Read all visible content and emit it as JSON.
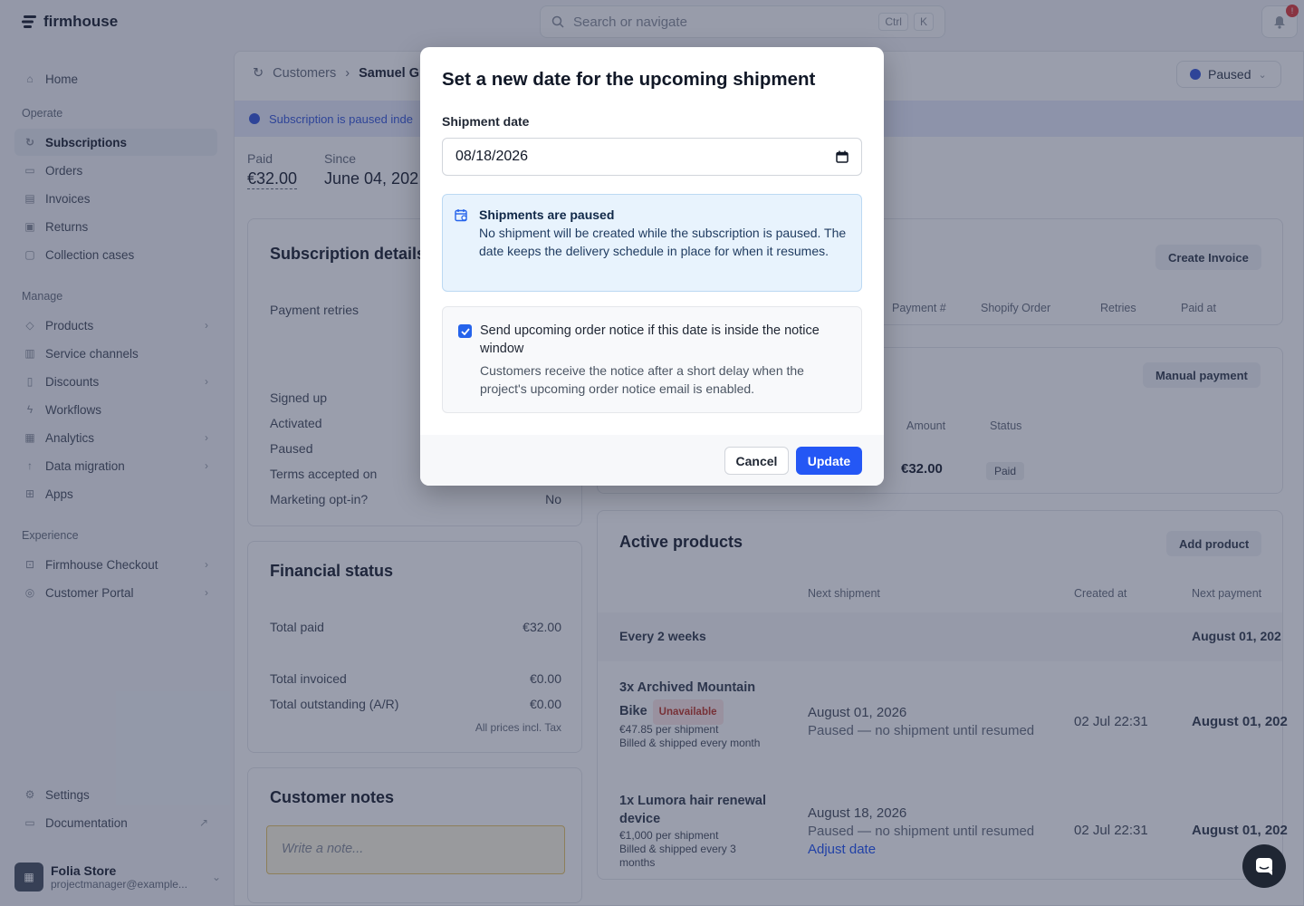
{
  "brand": {
    "name": "firmhouse"
  },
  "search": {
    "placeholder": "Search or navigate",
    "kbd1": "Ctrl",
    "kbd2": "K"
  },
  "notifications": {
    "count": "!"
  },
  "sidebar": {
    "home": "Home",
    "operate_label": "Operate",
    "operate": [
      "Subscriptions",
      "Orders",
      "Invoices",
      "Returns",
      "Collection cases"
    ],
    "manage_label": "Manage",
    "manage": [
      "Products",
      "Service channels",
      "Discounts",
      "Workflows",
      "Analytics",
      "Data migration",
      "Apps"
    ],
    "experience_label": "Experience",
    "experience": [
      "Firmhouse Checkout",
      "Customer Portal"
    ],
    "settings": "Settings",
    "documentation": "Documentation",
    "account": {
      "name": "Folia Store",
      "email": "projectmanager@example..."
    }
  },
  "page": {
    "breadcrumb_root": "Customers",
    "breadcrumb_current": "Samuel Gr",
    "status": "Paused",
    "banner": "Subscription is paused inde",
    "paid_label": "Paid",
    "paid_value": "€32.00",
    "since_label": "Since",
    "since_value": "June 04, 202"
  },
  "details": {
    "title": "Subscription details",
    "payment_retries": "Payment retries",
    "signed_up": "Signed up",
    "activated": "Activated",
    "paused": "Paused",
    "terms": "Terms accepted on",
    "marketing": "Marketing opt-in?",
    "marketing_value": "No"
  },
  "financial": {
    "title": "Financial status",
    "total_paid": "Total paid",
    "total_paid_value": "€32.00",
    "total_invoiced": "Total invoiced",
    "total_invoiced_value": "€0.00",
    "total_outstanding": "Total outstanding (A/R)",
    "total_outstanding_value": "€0.00",
    "note": "All prices incl. Tax"
  },
  "notes": {
    "title": "Customer notes",
    "placeholder": "Write a note..."
  },
  "invoices": {
    "create_button": "Create Invoice",
    "headers": [
      "Payment #",
      "Shopify Order",
      "Retries",
      "Paid at"
    ]
  },
  "payments": {
    "manual_button": "Manual payment",
    "headers": [
      "Amount",
      "Status"
    ],
    "amount": "€32.00",
    "status": "Paid"
  },
  "products": {
    "title": "Active products",
    "add_button": "Add product",
    "headers": [
      "Next shipment",
      "Created at",
      "Next payment"
    ],
    "group": "Every 2 weeks",
    "group_next_payment": "August 01, 202",
    "items": [
      {
        "name_line1": "3x Archived Mountain",
        "name_line2": "Bike",
        "badge": "Unavailable",
        "price": "€47.85 per shipment",
        "billing": "Billed & shipped every month",
        "next_shipment": "August 01, 2026",
        "note": "Paused — no shipment until resumed",
        "created": "02 Jul 22:31",
        "next_payment": "August 01, 202"
      },
      {
        "name_line1": "1x Lumora hair renewal",
        "name_line2": "device",
        "price": "€1,000 per shipment",
        "billing": "Billed & shipped every 3 months",
        "next_shipment": "August 18, 2026",
        "note": "Paused — no shipment until resumed",
        "link": "Adjust date",
        "created": "02 Jul 22:31",
        "next_payment": "August 01, 202"
      }
    ]
  },
  "modal": {
    "title": "Set a new date for the upcoming shipment",
    "date_label": "Shipment date",
    "date_value": "08/18/2026",
    "info_title": "Shipments are paused",
    "info_body": "No shipment will be created while the subscription is paused. The date keeps the delivery schedule in place for when it resumes.",
    "checkbox_label": "Send upcoming order notice if this date is inside the notice window",
    "checkbox_checked": true,
    "checkbox_help": "Customers receive the notice after a short delay when the project's upcoming order notice email is enabled.",
    "cancel": "Cancel",
    "update": "Update"
  },
  "colors": {
    "accent": "#2457f5",
    "info_bg": "#e8f3fd",
    "overlay": "rgba(30,41,72,0.45)"
  }
}
